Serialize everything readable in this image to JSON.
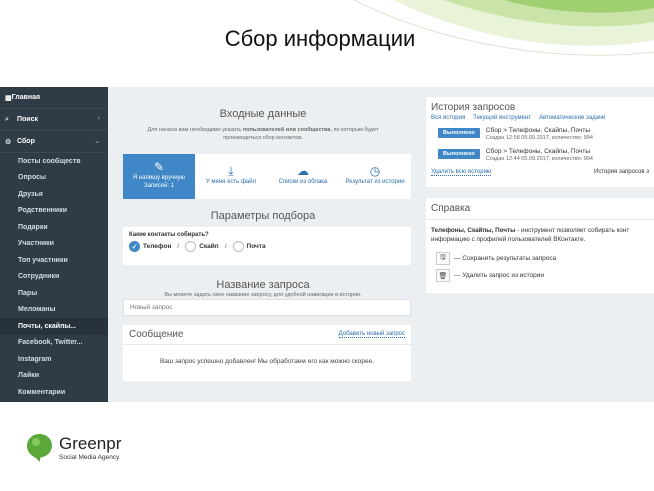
{
  "slide": {
    "title": "Сбор информации"
  },
  "sidebar": {
    "home": "Главная",
    "search": "Поиск",
    "collect": "Сбор",
    "items": [
      {
        "label": "Посты сообществ"
      },
      {
        "label": "Опросы"
      },
      {
        "label": "Друзья"
      },
      {
        "label": "Родственники"
      },
      {
        "label": "Подарки"
      },
      {
        "label": "Участники"
      },
      {
        "label": "Топ участники"
      },
      {
        "label": "Сотрудники"
      },
      {
        "label": "Пары"
      },
      {
        "label": "Меломаны"
      },
      {
        "label": "Почты, скайпы..."
      },
      {
        "label": "Facebook, Twitter..."
      },
      {
        "label": "Instagram"
      },
      {
        "label": "Лайки"
      },
      {
        "label": "Комментарии"
      }
    ]
  },
  "input": {
    "title": "Входные данные",
    "hint_pre": "Для начала вам необходимо указать ",
    "hint_bold": "пользователей или сообщества",
    "hint_post": ", по которым будет производиться сбор контактов.",
    "cards": [
      {
        "label": "Я напишу вручную",
        "sub": "Записей: 1"
      },
      {
        "label": "У меня есть файл"
      },
      {
        "label": "Списки из облака"
      },
      {
        "label": "Результат из истории"
      }
    ]
  },
  "params": {
    "title": "Параметры подбора",
    "question": "Какие контакты собирать?",
    "options": [
      "Телефон",
      "Скайп",
      "Почта"
    ],
    "separator": "/"
  },
  "query_name": {
    "title": "Название запроса",
    "hint": "Вы можете задать свое название запросу, для удобной навигации в истории.",
    "placeholder": "Новый запрос"
  },
  "message": {
    "title": "Сообщение",
    "link": "Добавить новый запрос",
    "text": "Ваш запрос успешно добавлен! Мы обработаем его как можно скорее."
  },
  "history": {
    "title": "История запросов",
    "tabs": [
      "Вся история",
      "Текущий инструмент",
      "Автоматические задачи"
    ],
    "rows": [
      {
        "status": "Выполнено",
        "name": "Сбор > Телефоны, Скайпы, Почты",
        "meta": "Создан 12:58 05.09.2017, количество: 994"
      },
      {
        "status": "Выполнено",
        "name": "Сбор > Телефоны, Скайпы, Почты",
        "meta": "Создан 12:44 05.09.2017, количество: 994"
      }
    ],
    "delete_all": "Удалить всю историю",
    "count_label": "История запросов з"
  },
  "help": {
    "title": "Справка",
    "text_bold": "Телефоны, Скайпы, Почты",
    "text": " - инструмент позволяет собирать конт информацию с профилей пользователей ВКонтакте.",
    "save": "— Сохранить результаты запроса",
    "delete": "— Удалить запрос из истории"
  },
  "logo": {
    "name": "Greenpr",
    "sub": "Social Media Agency"
  },
  "colors": {
    "accent": "#3f87c6",
    "sidebar": "#2f3b45",
    "link": "#2a6fb0",
    "logo_green": "#5aa83a"
  }
}
